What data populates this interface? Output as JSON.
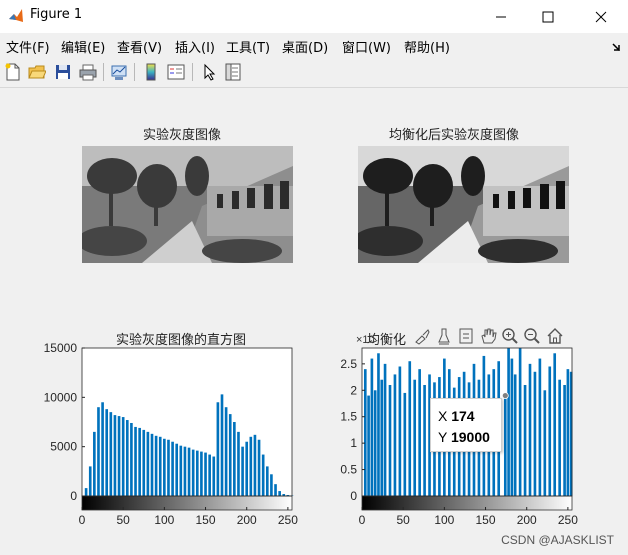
{
  "window": {
    "title": "Figure 1"
  },
  "menu": [
    "文件(F)",
    "编辑(E)",
    "查看(V)",
    "插入(I)",
    "工具(T)",
    "桌面(D)",
    "窗口(W)",
    "帮助(H)"
  ],
  "toolbar_icons": [
    "new-figure-icon",
    "open-file-icon",
    "save-icon",
    "print-icon",
    "link-plot-icon",
    "insert-colorbar-icon",
    "insert-legend-icon",
    "pointer-icon",
    "property-inspector-icon"
  ],
  "axes_toolbar_icons": [
    "brush-icon",
    "data-tips-icon",
    "zoom-in-icon",
    "pan-icon",
    "zoom-in-icon",
    "zoom-out-icon",
    "home-icon"
  ],
  "panels": {
    "top_left_title": "实验灰度图像",
    "top_right_title": "均衡化后实验灰度图像",
    "bottom_left_title": "实验灰度图像的直方图",
    "bottom_right_title": "均衡化",
    "exponent_label": "×10"
  },
  "datatip": {
    "x_label": "X",
    "x_value": "174",
    "y_label": "Y",
    "y_value": "19000"
  },
  "watermark": "CSDN @AJASKLIST",
  "chart_data": [
    {
      "type": "bar",
      "title": "实验灰度图像的直方图",
      "xlim": [
        0,
        255
      ],
      "ylim": [
        0,
        15000
      ],
      "xticks": [
        "0",
        "50",
        "100",
        "150",
        "200",
        "250"
      ],
      "yticks": [
        "0",
        "5000",
        "10000",
        "15000"
      ],
      "x": [
        5,
        10,
        15,
        20,
        25,
        30,
        35,
        40,
        45,
        50,
        55,
        60,
        65,
        70,
        75,
        80,
        85,
        90,
        95,
        100,
        105,
        110,
        115,
        120,
        125,
        130,
        135,
        140,
        145,
        150,
        155,
        160,
        165,
        170,
        175,
        180,
        185,
        190,
        195,
        200,
        205,
        210,
        215,
        220,
        225,
        230,
        235,
        240,
        245,
        250,
        255
      ],
      "values": [
        800,
        3000,
        6500,
        9000,
        9500,
        8800,
        8500,
        8200,
        8100,
        8000,
        7700,
        7400,
        7000,
        6900,
        6700,
        6500,
        6300,
        6100,
        6000,
        5800,
        5700,
        5500,
        5300,
        5100,
        5000,
        4900,
        4700,
        4600,
        4500,
        4400,
        4200,
        4000,
        9500,
        10300,
        9000,
        8300,
        7500,
        6500,
        5000,
        5500,
        6000,
        6200,
        5700,
        4200,
        3000,
        2200,
        1200,
        500,
        200,
        100,
        50
      ],
      "color": "#0072BD",
      "colorbar": "gray"
    },
    {
      "type": "bar",
      "title": "均衡化",
      "xlim": [
        0,
        255
      ],
      "ylim": [
        0,
        28000
      ],
      "y_exponent": 4,
      "xticks": [
        "0",
        "50",
        "100",
        "150",
        "200",
        "250"
      ],
      "yticks": [
        "0",
        "0.5",
        "1",
        "1.5",
        "2",
        "2.5"
      ],
      "x": [
        4,
        8,
        12,
        16,
        20,
        24,
        28,
        34,
        40,
        46,
        52,
        58,
        64,
        70,
        76,
        82,
        88,
        94,
        100,
        106,
        112,
        118,
        124,
        130,
        136,
        142,
        148,
        154,
        160,
        166,
        174,
        178,
        182,
        186,
        192,
        198,
        204,
        210,
        216,
        222,
        228,
        234,
        240,
        246,
        250,
        254
      ],
      "values": [
        24000,
        19000,
        26000,
        20000,
        27000,
        22000,
        25000,
        21000,
        23000,
        24500,
        19500,
        25500,
        22000,
        24000,
        21000,
        23000,
        21500,
        22500,
        26000,
        24000,
        20500,
        22500,
        23500,
        21500,
        25000,
        22000,
        26500,
        23000,
        24000,
        25500,
        19000,
        28000,
        26000,
        23000,
        28000,
        21000,
        25000,
        23500,
        26000,
        20000,
        24500,
        27000,
        22000,
        21000,
        24000,
        23500
      ],
      "color": "#0072BD",
      "colorbar": "gray"
    }
  ]
}
